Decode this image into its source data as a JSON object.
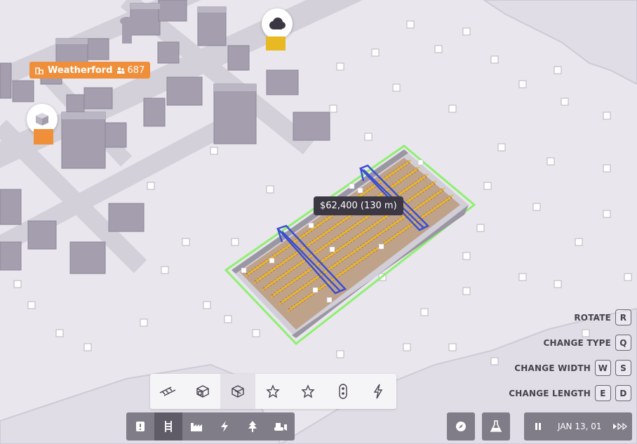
{
  "town": {
    "name": "Weatherford",
    "population": "687"
  },
  "placement": {
    "cost_label": "$62,400 (130 m)"
  },
  "hints": [
    {
      "label": "ROTATE",
      "keys": [
        "R"
      ]
    },
    {
      "label": "CHANGE TYPE",
      "keys": [
        "Q"
      ]
    },
    {
      "label": "CHANGE WIDTH",
      "keys": [
        "W",
        "S"
      ]
    },
    {
      "label": "CHANGE LENGTH",
      "keys": [
        "E",
        "D"
      ]
    }
  ],
  "palette": {
    "items": [
      "track-icon",
      "depot-icon",
      "station-icon",
      "star-icon",
      "star-outline-icon",
      "signal-icon",
      "lightning-icon"
    ],
    "selected_index": 2
  },
  "toolbar": {
    "items": [
      "info-icon",
      "rail-icon",
      "industry-icon",
      "power-icon",
      "tree-icon",
      "bulldozer-icon"
    ],
    "selected_index": 1
  },
  "time": {
    "date": "JAN 13, 01"
  },
  "colors": {
    "accent": "#f08f3a",
    "selection": "#8ef070",
    "crane": "#3a4fd0",
    "track_rail": "#e8b923",
    "sleeper": "#b47a5a"
  }
}
